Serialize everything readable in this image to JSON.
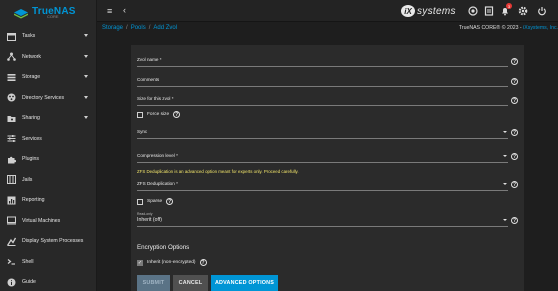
{
  "sidebar": {
    "logo_text": "TrueNAS",
    "logo_sub": "CORE",
    "items": [
      {
        "label": "Tasks",
        "icon": "calendar-icon",
        "caret": true
      },
      {
        "label": "Network",
        "icon": "network-icon",
        "caret": true
      },
      {
        "label": "Storage",
        "icon": "storage-icon",
        "caret": true
      },
      {
        "label": "Directory Services",
        "icon": "directory-services-icon",
        "caret": true
      },
      {
        "label": "Sharing",
        "icon": "folder-share-icon",
        "caret": true
      },
      {
        "label": "Services",
        "icon": "sliders-icon",
        "caret": false
      },
      {
        "label": "Plugins",
        "icon": "puzzle-icon",
        "caret": false
      },
      {
        "label": "Jails",
        "icon": "jail-icon",
        "caret": false
      },
      {
        "label": "Reporting",
        "icon": "chart-icon",
        "caret": false
      },
      {
        "label": "Virtual Machines",
        "icon": "monitor-icon",
        "caret": false
      },
      {
        "label": "Display System Processes",
        "icon": "processes-icon",
        "caret": false
      },
      {
        "label": "Shell",
        "icon": "terminal-icon",
        "caret": false
      },
      {
        "label": "Guide",
        "icon": "info-icon",
        "caret": false
      }
    ]
  },
  "topbar": {
    "menu_icon": "≡",
    "back_icon": "‹",
    "brand_mark": "iX",
    "brand_text": "systems",
    "notification_count": "3"
  },
  "breadcrumb": {
    "items": [
      "Storage",
      "Pools",
      "Add Zvol"
    ]
  },
  "copyright": {
    "prefix": "TrueNAS CORE® © 2023 - ",
    "company": "iXsystems, Inc."
  },
  "form": {
    "zvol_name_label": "Zvol name *",
    "comments_label": "Comments",
    "size_label": "Size for this zvol *",
    "force_size_label": "Force size",
    "sync_label": "Sync",
    "compression_label": "Compression level *",
    "dedup_warning": "ZFS Deduplication is an advanced option meant for experts only. Proceed carefully.",
    "dedup_label": "ZFS Deduplication *",
    "sparse_label": "Sparse",
    "readonly_label": "Read-only",
    "readonly_value": "Inherit (off)",
    "encryption_title": "Encryption Options",
    "inherit_label": "Inherit (non-encrypted)"
  },
  "buttons": {
    "submit": "SUBMIT",
    "cancel": "CANCEL",
    "advanced": "ADVANCED OPTIONS"
  },
  "colors": {
    "accent": "#0095d5",
    "warning": "#f0e36a",
    "notification": "#e53935"
  }
}
